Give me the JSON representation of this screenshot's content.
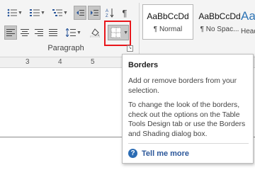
{
  "ribbon": {
    "group_label": "Paragraph",
    "styles": [
      {
        "sample": "AaBbCcDd",
        "name": "¶ Normal"
      },
      {
        "sample": "AaBbCcDd",
        "name": "¶ No Spac..."
      },
      {
        "sample": "AaBl",
        "name": "Headi"
      }
    ],
    "icons": {
      "bullets": "bullets-icon",
      "numbering": "numbering-icon",
      "multilevel": "multilevel-list-icon",
      "decrease_indent": "decrease-indent-icon",
      "increase_indent": "increase-indent-icon",
      "sort": "sort-icon",
      "show_marks": "pilcrow-icon",
      "align_left": "align-left-icon",
      "center": "align-center-icon",
      "align_right": "align-right-icon",
      "justify": "justify-icon",
      "line_spacing": "line-spacing-icon",
      "shading": "shading-icon",
      "borders": "borders-icon"
    },
    "highlight_color": "#e8161b"
  },
  "ruler": {
    "marks": [
      "3",
      "4",
      "5"
    ]
  },
  "tooltip": {
    "title": "Borders",
    "description": "Add or remove borders from your selection.",
    "details": "To change the look of the borders, check out the options on the Table Tools Design tab or use the Borders and Shading dialog box.",
    "help_link": "Tell me more"
  },
  "colors": {
    "accent": "#2b579a",
    "heading_style": "#2e74b5"
  }
}
